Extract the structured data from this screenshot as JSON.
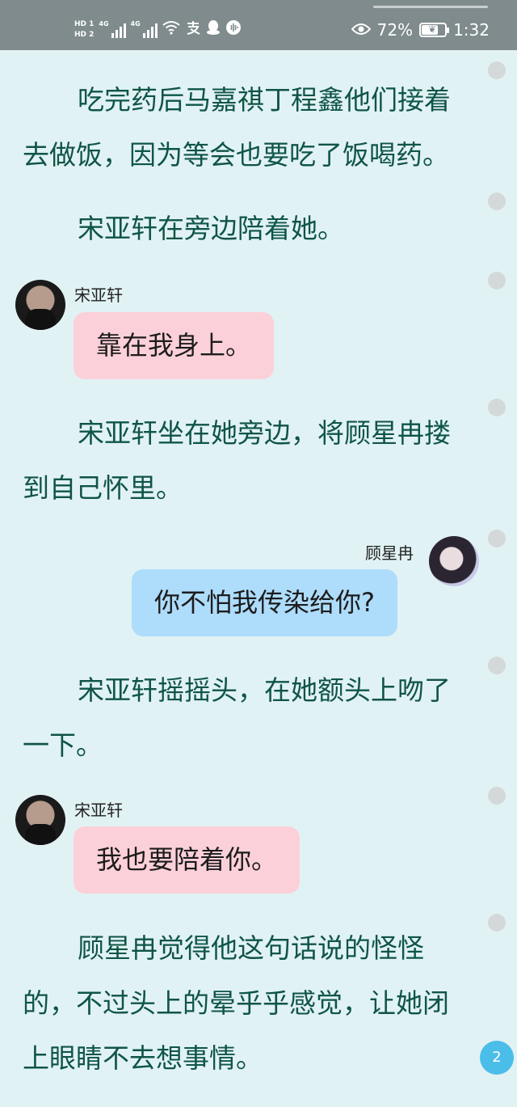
{
  "status_bar": {
    "hd1": "HD 1",
    "hd2": "HD 2",
    "net1": "4G",
    "net2": "4G",
    "battery_percent": "72%",
    "battery_level": 0.72,
    "time": "1:32",
    "icons": [
      "signal-icon",
      "signal-icon",
      "wifi-icon",
      "alipay-icon",
      "qq-icon",
      "audio-icon",
      "eye-icon",
      "battery-icon"
    ]
  },
  "story": {
    "p1": "吃完药后马嘉祺丁程鑫他们接着去做饭，因为等会也要吃了饭喝药。",
    "p2": "宋亚轩在旁边陪着她。",
    "chat1_name": "宋亚轩",
    "chat1_text": "靠在我身上。",
    "p3": "宋亚轩坐在她旁边，将顾星冉搂到自己怀里。",
    "chat2_name": "顾星冉",
    "chat2_text": "你不怕我传染给你?",
    "p4": "宋亚轩摇摇头，在她额头上吻了一下。",
    "chat3_name": "宋亚轩",
    "chat3_text": "我也要陪着你。",
    "p5": "顾星冉觉得他这句话说的怪怪的，不过头上的晕乎乎感觉，让她闭上眼睛不去想事情。"
  },
  "page_badge": "2",
  "colors": {
    "background": "#e1f2f4",
    "text": "#0f5546",
    "pink_bubble": "#fcd0d9",
    "blue_bubble": "#aedcfb",
    "badge": "#4bbde9"
  }
}
